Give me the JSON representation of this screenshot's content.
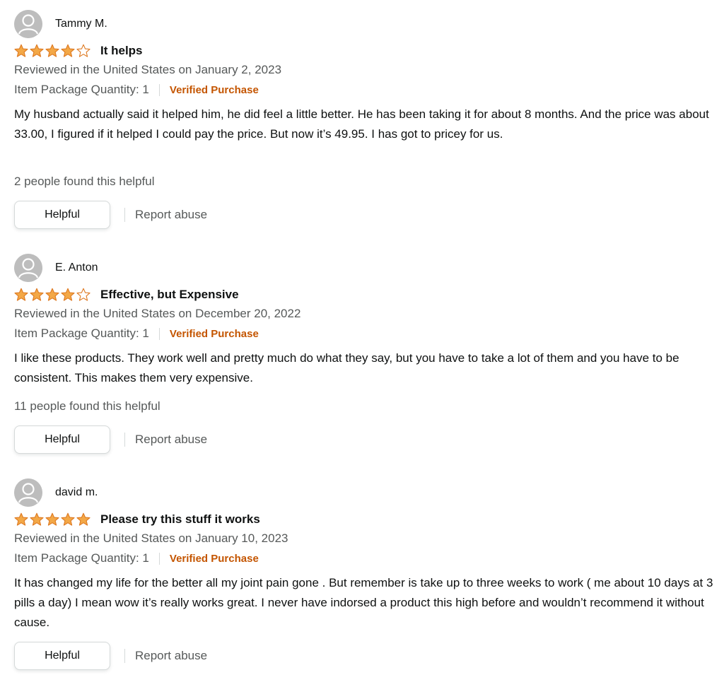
{
  "colors": {
    "star": "#f3a847",
    "star_outline": "#de7921",
    "verified": "#c45500",
    "muted_text": "#565959",
    "avatar_bg": "#bdbdbd"
  },
  "reviews": [
    {
      "profile_name": "Tammy M.",
      "rating": 4,
      "title": "It helps",
      "date": "Reviewed in the United States on January 2, 2023",
      "item_info": "Item Package Quantity: 1",
      "verified": "Verified Purchase",
      "body": "My husband actually said it helped him, he did feel a little better. He has been taking it for about 8 months. And the price was about 33.00, I figured if it helped I could pay the price. But now it’s 49.95. I has got to pricey for us.",
      "helpful_count": "2 people found this helpful",
      "helpful_label": "Helpful",
      "report_label": "Report abuse"
    },
    {
      "profile_name": "E. Anton",
      "rating": 4,
      "title": "Effective, but Expensive",
      "date": "Reviewed in the United States on December 20, 2022",
      "item_info": "Item Package Quantity: 1",
      "verified": "Verified Purchase",
      "body": "I like these products. They work well and pretty much do what they say, but you have to take a lot of them and you have to be consistent. This makes them very expensive.",
      "helpful_count": "11 people found this helpful",
      "helpful_label": "Helpful",
      "report_label": "Report abuse"
    },
    {
      "profile_name": "david m.",
      "rating": 5,
      "title": "Please try this stuff it works",
      "date": "Reviewed in the United States on January 10, 2023",
      "item_info": "Item Package Quantity: 1",
      "verified": "Verified Purchase",
      "body": "It has changed my life for the better all my joint pain gone . But remember is take up to three weeks to work ( me about 10 days at 3 pills a day) I mean wow it’s really works great. I never have indorsed a product this high before and wouldn’t recommend it without cause.",
      "helpful_count": "",
      "helpful_label": "Helpful",
      "report_label": "Report abuse"
    }
  ]
}
